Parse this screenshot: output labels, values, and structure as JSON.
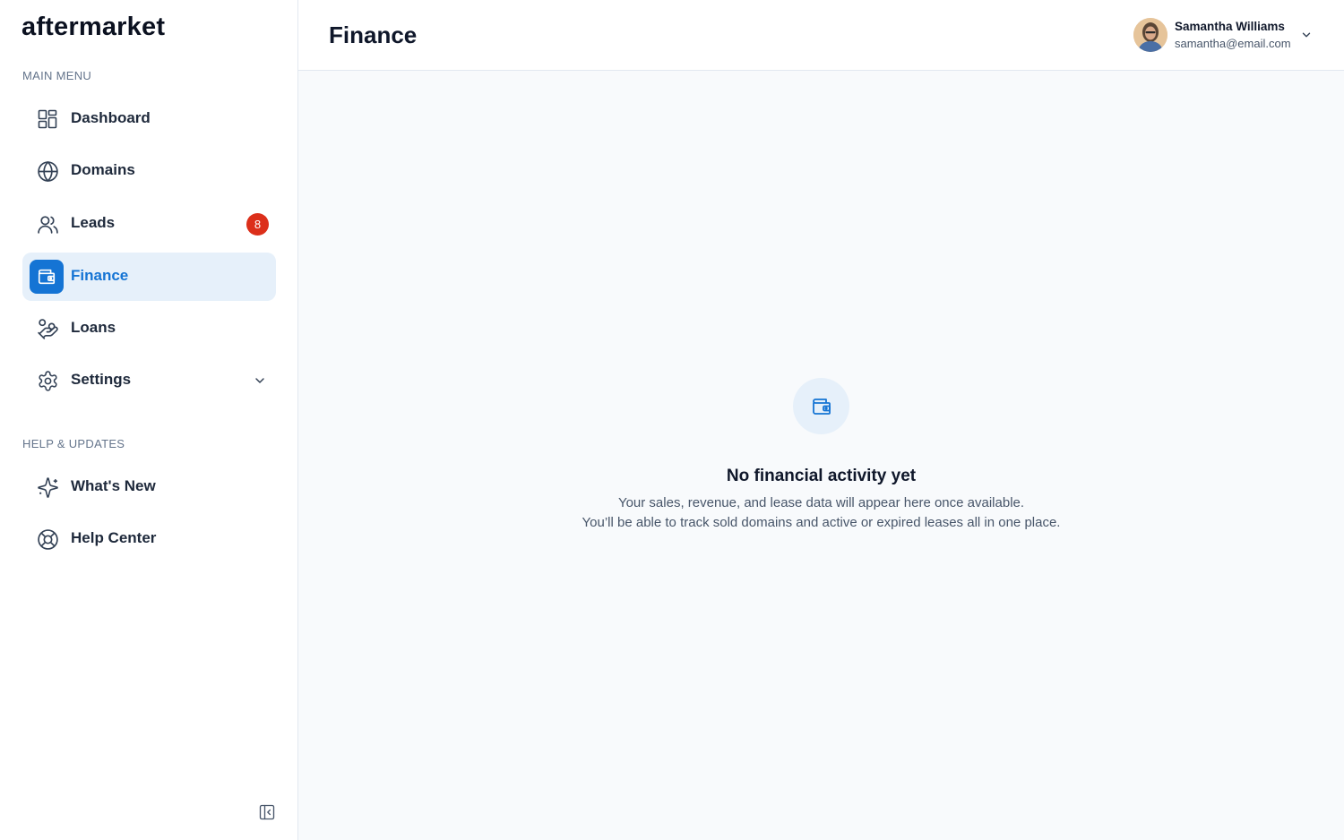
{
  "app": {
    "logo": "aftermarket"
  },
  "sidebar": {
    "main_menu_label": "MAIN MENU",
    "help_label": "HELP & UPDATES",
    "items": [
      {
        "label": "Dashboard",
        "icon": "dashboard-icon"
      },
      {
        "label": "Domains",
        "icon": "globe-icon"
      },
      {
        "label": "Leads",
        "icon": "users-icon",
        "badge": "8"
      },
      {
        "label": "Finance",
        "icon": "wallet-icon",
        "active": true
      },
      {
        "label": "Loans",
        "icon": "hand-coins-icon"
      },
      {
        "label": "Settings",
        "icon": "gear-icon",
        "expandable": true
      }
    ],
    "help_items": [
      {
        "label": "What's New",
        "icon": "sparkles-icon"
      },
      {
        "label": "Help Center",
        "icon": "lifebuoy-icon"
      }
    ]
  },
  "header": {
    "title": "Finance",
    "user": {
      "name": "Samantha Williams",
      "email": "samantha@email.com"
    }
  },
  "empty_state": {
    "icon": "wallet-icon",
    "title": "No financial activity yet",
    "line1": "Your sales, revenue, and lease data will appear here once available.",
    "line2": "You’ll be able to track sold domains and active or expired leases all in one place."
  },
  "colors": {
    "accent": "#1574d4",
    "active_bg": "#e6f0fa",
    "badge": "#dc2f1a",
    "page_bg": "#f8fafc"
  }
}
